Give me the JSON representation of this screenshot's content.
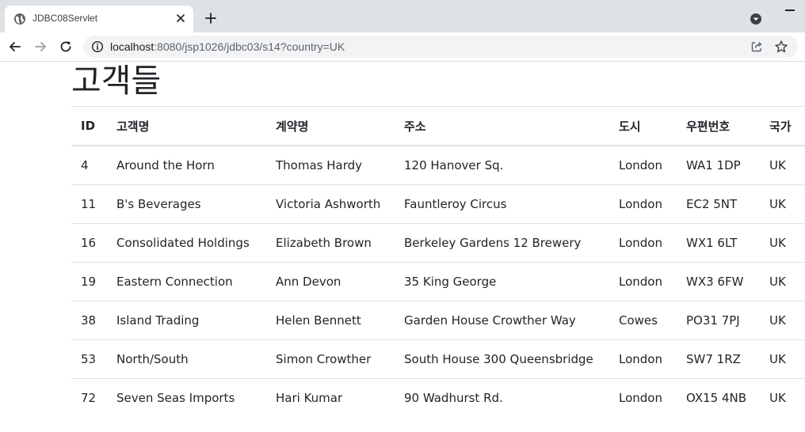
{
  "browser": {
    "tab_title": "JDBC08Servlet",
    "url_host": "localhost",
    "url_rest": ":8080/jsp1026/jdbc03/s14?country=UK"
  },
  "page": {
    "title": "고객들"
  },
  "table": {
    "headers": [
      "ID",
      "고객명",
      "계약명",
      "주소",
      "도시",
      "우편번호",
      "국가"
    ],
    "rows": [
      [
        "4",
        "Around the Horn",
        "Thomas Hardy",
        "120 Hanover Sq.",
        "London",
        "WA1 1DP",
        "UK"
      ],
      [
        "11",
        "B's Beverages",
        "Victoria Ashworth",
        "Fauntleroy Circus",
        "London",
        "EC2 5NT",
        "UK"
      ],
      [
        "16",
        "Consolidated Holdings",
        "Elizabeth Brown",
        "Berkeley Gardens 12 Brewery",
        "London",
        "WX1 6LT",
        "UK"
      ],
      [
        "19",
        "Eastern Connection",
        "Ann Devon",
        "35 King George",
        "London",
        "WX3 6FW",
        "UK"
      ],
      [
        "38",
        "Island Trading",
        "Helen Bennett",
        "Garden House Crowther Way",
        "Cowes",
        "PO31 7PJ",
        "UK"
      ],
      [
        "53",
        "North/South",
        "Simon Crowther",
        "South House 300 Queensbridge",
        "London",
        "SW7 1RZ",
        "UK"
      ],
      [
        "72",
        "Seven Seas Imports",
        "Hari Kumar",
        "90 Wadhurst Rd.",
        "London",
        "OX15 4NB",
        "UK"
      ]
    ]
  }
}
